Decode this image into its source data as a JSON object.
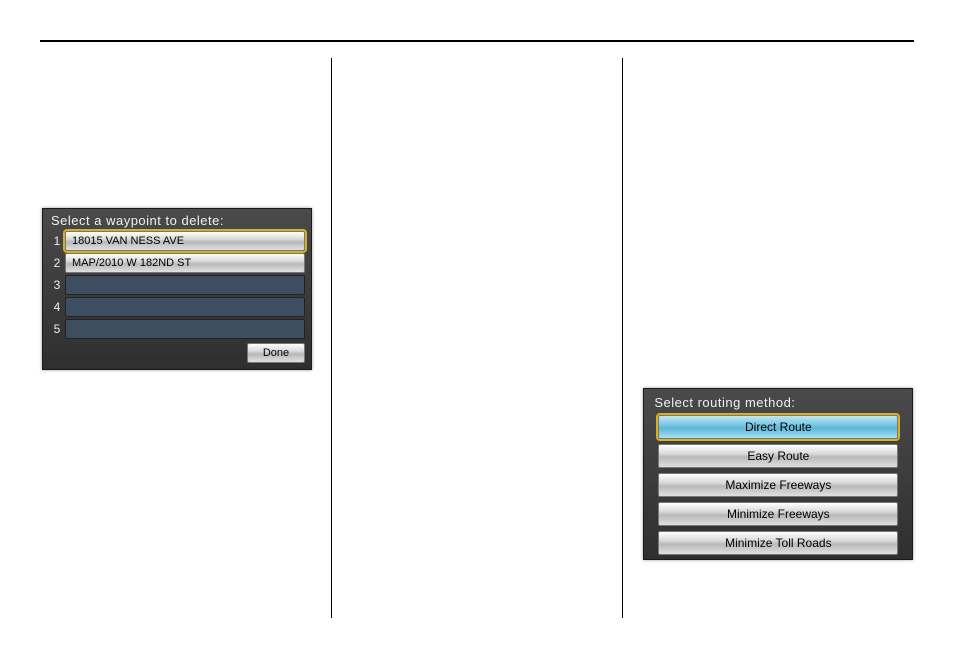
{
  "waypoint_screen": {
    "title": "Select a waypoint to delete:",
    "rows": {
      "r1_num": "1",
      "r1_text": "18015 VAN NESS AVE",
      "r2_num": "2",
      "r2_text": "MAP/2010 W 182ND ST",
      "r3_num": "3",
      "r4_num": "4",
      "r5_num": "5"
    },
    "done_label": "Done"
  },
  "routing_screen": {
    "title": "Select routing method:",
    "options": {
      "o1": "Direct Route",
      "o2": "Easy Route",
      "o3": "Maximize Freeways",
      "o4": "Minimize Freeways",
      "o5": "Minimize Toll Roads"
    }
  }
}
